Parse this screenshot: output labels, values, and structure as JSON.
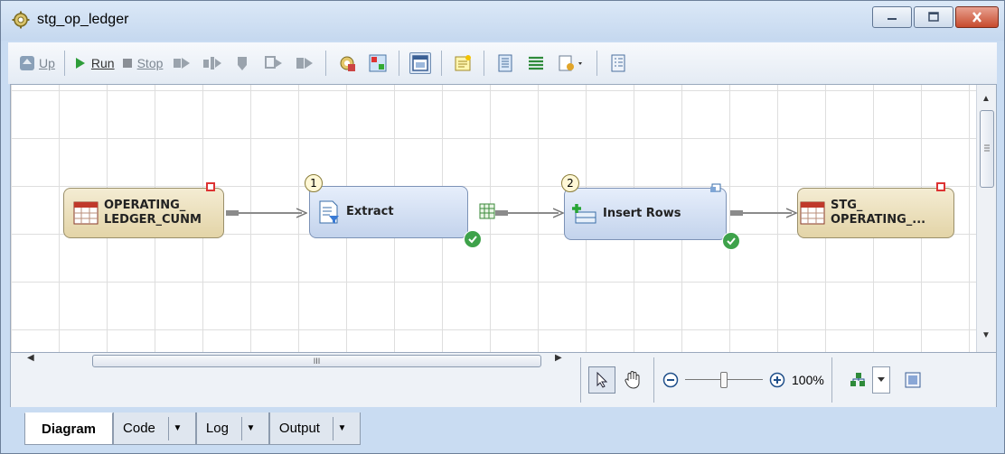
{
  "window": {
    "title": "stg_op_ledger",
    "icon": "job-gear-icon"
  },
  "toolbar": {
    "up_label": "Up",
    "run_label": "Run",
    "stop_label": "Stop"
  },
  "diagram": {
    "nodes": [
      {
        "id": "source",
        "line1": "OPERATING_",
        "line2": "LEDGER_CUNM",
        "kind": "table"
      },
      {
        "id": "extract",
        "label": "Extract",
        "step": "1",
        "kind": "transformation"
      },
      {
        "id": "insert",
        "label": "Insert Rows",
        "step": "2",
        "kind": "transformation"
      },
      {
        "id": "target",
        "line1": "STG_",
        "line2": "OPERATING_...",
        "kind": "table"
      }
    ]
  },
  "zoom": {
    "level": "100%",
    "fraction": 0.5
  },
  "hscroll": {
    "thumb_grip": "III"
  },
  "tabs": [
    {
      "label": "Diagram",
      "active": true
    },
    {
      "label": "Code",
      "active": false
    },
    {
      "label": "Log",
      "active": false
    },
    {
      "label": "Output",
      "active": false
    }
  ],
  "colors": {
    "table_node": "#e3d4a7",
    "transform_node": "#c3d3ec",
    "status_ok": "#3ea24a",
    "close_button": "#c74a2d"
  }
}
